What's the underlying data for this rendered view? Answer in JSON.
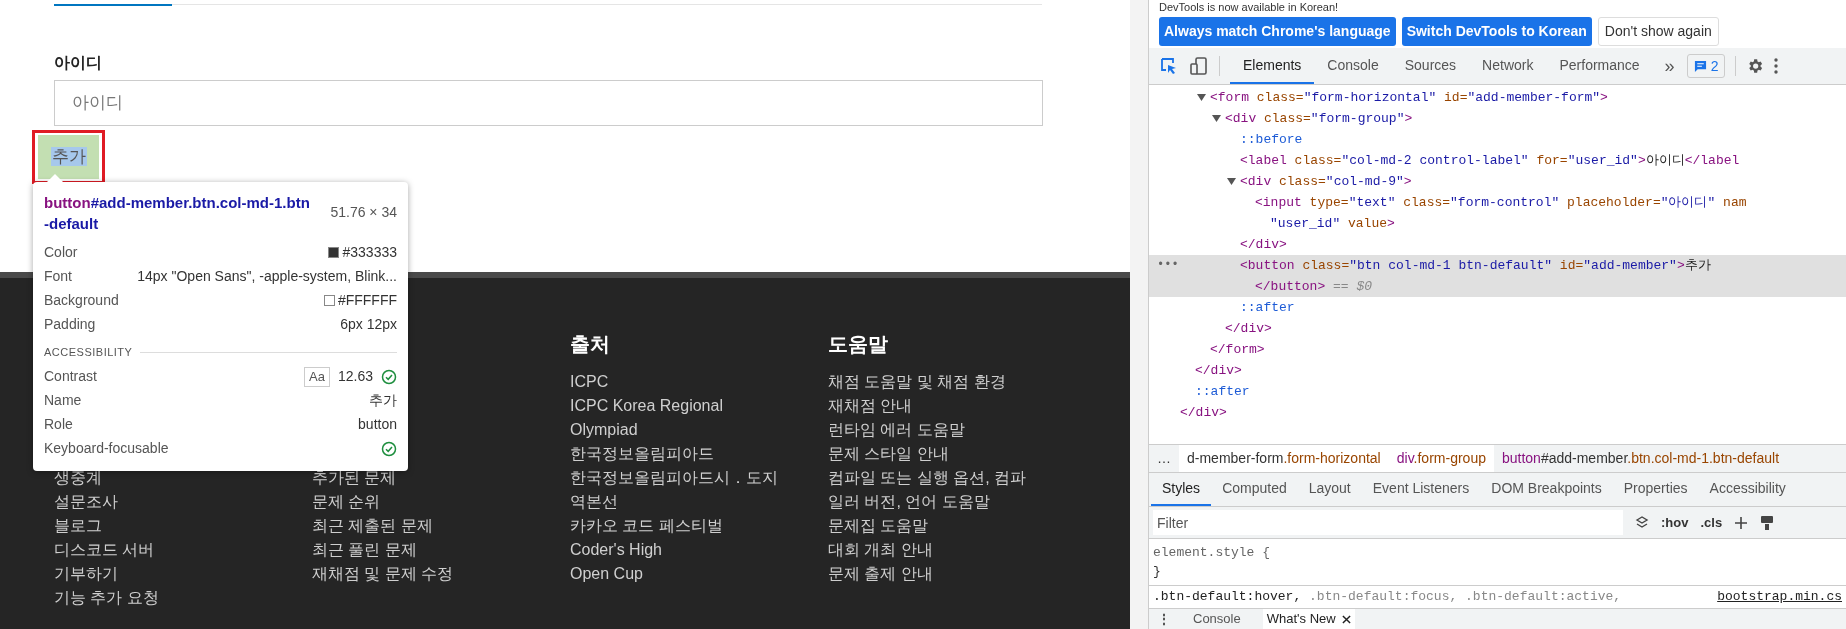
{
  "page": {
    "field_label": "아이디",
    "field": {
      "placeholder": "아이디"
    },
    "add_button": "추가",
    "footer": {
      "columns": [
        {
          "items": [
            "생중계",
            "설문조사",
            "블로그",
            "디스코드 서버",
            "기부하기",
            "기능 추가 요청"
          ],
          "offset_rows": true
        },
        {
          "items": [
            "추가된 문제",
            "문제 순위",
            "최근 제출된 문제",
            "최근 풀린 문제",
            "재채점 및 문제 수정"
          ],
          "offset_rows": true
        },
        {
          "heading": "출처",
          "items": [
            "ICPC",
            "ICPC Korea Regional",
            "Olympiad",
            "한국정보올림피아드",
            "한국정보올림피아드시．도지",
            "역본선",
            "카카오 코드 페스티벌",
            "Coder's High",
            "Open Cup"
          ],
          "offset_rows": false
        },
        {
          "heading": "도움말",
          "items": [
            "채점 도움말 및 채점 환경",
            "재채점 안내",
            "런타임 에러 도움말",
            "문제 스타일 안내",
            "컴파일 또는 실행 옵션, 컴파",
            "일러 버전, 언어 도움말",
            "문제집 도움말",
            "대회 개최 안내",
            "문제 출제 안내"
          ],
          "offset_rows": false
        }
      ]
    }
  },
  "inspect_tooltip": {
    "selector_tag": "button",
    "selector_rest": "#add-member.btn.col-md-1.btn-default",
    "size": "51.76 × 34",
    "rows": [
      {
        "label": "Color",
        "value": "#333333",
        "swatch": true
      },
      {
        "label": "Font",
        "value": "14px \"Open Sans\", -apple-system, Blink...",
        "swatch": false
      },
      {
        "label": "Background",
        "value": "#FFFFFF",
        "swatch": true
      },
      {
        "label": "Padding",
        "value": "6px 12px",
        "swatch": false
      }
    ],
    "section": "ACCESSIBILITY",
    "accessibility": [
      {
        "label": "Contrast",
        "value": "12.63",
        "kind": "contrast",
        "badge": "Aa"
      },
      {
        "label": "Name",
        "value": "추가",
        "kind": "text"
      },
      {
        "label": "Role",
        "value": "button",
        "kind": "text"
      },
      {
        "label": "Keyboard-focusable",
        "kind": "check"
      }
    ]
  },
  "devtools": {
    "notice": "DevTools is now available in Korean!",
    "notice_buttons": [
      {
        "label": "Always match Chrome's language",
        "kind": "primary"
      },
      {
        "label": "Switch DevTools to Korean",
        "kind": "primary"
      },
      {
        "label": "Don't show again",
        "kind": "secondary"
      }
    ],
    "tabs": [
      {
        "label": "Elements",
        "selected": true
      },
      {
        "label": "Console",
        "selected": false
      },
      {
        "label": "Sources",
        "selected": false
      },
      {
        "label": "Network",
        "selected": false
      },
      {
        "label": "Performance",
        "selected": false
      }
    ],
    "more_tabs": "»",
    "issues_count": "2",
    "row_menu": "•••",
    "breadcrumb_overflow": "…",
    "drawer_menu": "⋮",
    "elements_tree": [
      {
        "children": [
          {
            "children": [
              {
                "lines": [
                  [
                    {
                      "kind": "tag",
                      "text": "<form"
                    },
                    {
                      "kind": "attr",
                      "text": " class="
                    },
                    {
                      "kind": "value",
                      "text": "\"form-horizontal\""
                    },
                    {
                      "kind": "attr",
                      "text": " id="
                    },
                    {
                      "kind": "value",
                      "text": "\"add-member-form\""
                    },
                    {
                      "kind": "tag",
                      "text": ">"
                    }
                  ]
                ],
                "expanded": true,
                "selected": false,
                "children": [
                  {
                    "lines": [
                      [
                        {
                          "kind": "tag",
                          "text": "<div"
                        },
                        {
                          "kind": "attr",
                          "text": " class="
                        },
                        {
                          "kind": "value",
                          "text": "\"form-group\""
                        },
                        {
                          "kind": "tag",
                          "text": ">"
                        }
                      ]
                    ],
                    "expanded": true,
                    "selected": false,
                    "children": [
                      {
                        "lines": [
                          [
                            {
                              "kind": "pseudo",
                              "text": "::before"
                            }
                          ]
                        ],
                        "selected": false
                      },
                      {
                        "lines": [
                          [
                            {
                              "kind": "tag",
                              "text": "<label"
                            },
                            {
                              "kind": "attr",
                              "text": " class="
                            },
                            {
                              "kind": "value",
                              "text": "\"col-md-2 control-label\""
                            },
                            {
                              "kind": "attr",
                              "text": " for="
                            },
                            {
                              "kind": "value",
                              "text": "\"user_id\""
                            },
                            {
                              "kind": "tag",
                              "text": ">"
                            },
                            {
                              "kind": "text",
                              "text": "아이디"
                            },
                            {
                              "kind": "tag",
                              "text": "</label"
                            }
                          ]
                        ],
                        "selected": false
                      },
                      {
                        "lines": [
                          [
                            {
                              "kind": "tag",
                              "text": "<div"
                            },
                            {
                              "kind": "attr",
                              "text": " class="
                            },
                            {
                              "kind": "value",
                              "text": "\"col-md-9\""
                            },
                            {
                              "kind": "tag",
                              "text": ">"
                            }
                          ]
                        ],
                        "expanded": true,
                        "selected": false,
                        "children": [
                          {
                            "lines": [
                              [
                                {
                                  "kind": "tag",
                                  "text": "<input"
                                },
                                {
                                  "kind": "attr",
                                  "text": " type="
                                },
                                {
                                  "kind": "value",
                                  "text": "\"text\""
                                },
                                {
                                  "kind": "attr",
                                  "text": " class="
                                },
                                {
                                  "kind": "value",
                                  "text": "\"form-control\""
                                },
                                {
                                  "kind": "attr",
                                  "text": " placeholder="
                                },
                                {
                                  "kind": "value",
                                  "text": "\"아이디\""
                                },
                                {
                                  "kind": "attr",
                                  "text": " nam"
                                }
                              ],
                              [
                                {
                                  "kind": "value",
                                  "text": "\"user_id\""
                                },
                                {
                                  "kind": "attr",
                                  "text": " value"
                                },
                                {
                                  "kind": "tag",
                                  "text": ">"
                                }
                              ]
                            ],
                            "selected": false
                          }
                        ],
                        "close": [
                          {
                            "kind": "tag",
                            "text": "</div>"
                          }
                        ]
                      },
                      {
                        "lines": [
                          [
                            {
                              "kind": "tag",
                              "text": "<button"
                            },
                            {
                              "kind": "attr",
                              "text": " class="
                            },
                            {
                              "kind": "value",
                              "text": "\"btn col-md-1 btn-default\""
                            },
                            {
                              "kind": "attr",
                              "text": " id="
                            },
                            {
                              "kind": "value",
                              "text": "\"add-member\""
                            },
                            {
                              "kind": "tag",
                              "text": ">"
                            },
                            {
                              "kind": "text",
                              "text": "추가"
                            }
                          ],
                          [
                            {
                              "kind": "tag",
                              "text": "</button>"
                            },
                            {
                              "kind": "hint",
                              "text": " == $0"
                            }
                          ]
                        ],
                        "selected": true
                      },
                      {
                        "lines": [
                          [
                            {
                              "kind": "pseudo",
                              "text": "::after"
                            }
                          ]
                        ],
                        "selected": false
                      }
                    ],
                    "close": [
                      {
                        "kind": "tag",
                        "text": "</div>"
                      }
                    ]
                  }
                ],
                "close": [
                  {
                    "kind": "tag",
                    "text": "</form>"
                  }
                ]
              }
            ],
            "close": [
              {
                "kind": "tag",
                "text": "</div>"
              }
            ]
          },
          {
            "lines": [
              [
                {
                  "kind": "pseudo",
                  "text": "::after"
                }
              ]
            ],
            "selected": false
          }
        ],
        "close": [
          {
            "kind": "tag",
            "text": "</div>"
          }
        ]
      }
    ],
    "breadcrumbs": [
      {
        "parts": [
          {
            "kind": "id",
            "text": "d-member-form"
          },
          {
            "kind": "cls",
            "text": ".form-horizontal"
          }
        ],
        "selected": false
      },
      {
        "parts": [
          {
            "kind": "tag",
            "text": "div"
          },
          {
            "kind": "cls",
            "text": ".form-group"
          }
        ],
        "selected": false
      },
      {
        "parts": [
          {
            "kind": "tag",
            "text": "button"
          },
          {
            "kind": "id",
            "text": "#add-member"
          },
          {
            "kind": "cls",
            "text": ".btn.col-md-1.btn-default"
          }
        ],
        "selected": true
      }
    ],
    "sub_tabs": [
      {
        "label": "Styles",
        "selected": true
      },
      {
        "label": "Computed",
        "selected": false
      },
      {
        "label": "Layout",
        "selected": false
      },
      {
        "label": "Event Listeners",
        "selected": false
      },
      {
        "label": "DOM Breakpoints",
        "selected": false
      },
      {
        "label": "Properties",
        "selected": false
      },
      {
        "label": "Accessibility",
        "selected": false
      }
    ],
    "filter": {
      "placeholder": "Filter"
    },
    "hov": ":hov",
    "cls": ".cls",
    "rules": [
      {
        "selector": "element.style {",
        "close": "}"
      }
    ],
    "next_rule": {
      "selectors": [
        {
          "text": ".btn-default:hover,",
          "matched": true
        },
        {
          "text": ".btn-default:focus,",
          "matched": false
        },
        {
          "text": ".btn-default:active,",
          "matched": false
        }
      ],
      "source": "bootstrap.min.cs"
    },
    "drawer_tabs": [
      {
        "label": "Console",
        "selected": false,
        "closable": false
      },
      {
        "label": "What's New",
        "selected": true,
        "closable": true
      }
    ]
  }
}
